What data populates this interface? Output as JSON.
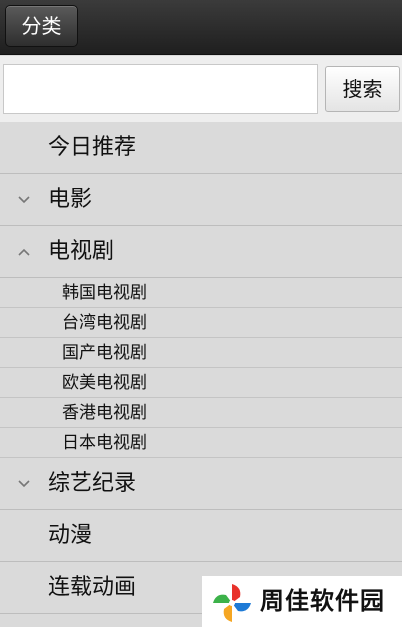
{
  "topbar": {
    "category_button": "分类"
  },
  "search": {
    "value": "",
    "placeholder": "",
    "button": "搜索"
  },
  "menu": {
    "items": [
      {
        "label": "今日推荐",
        "expandable": false
      },
      {
        "label": "电影",
        "expandable": true,
        "expanded": false
      },
      {
        "label": "电视剧",
        "expandable": true,
        "expanded": true,
        "children": [
          "韩国电视剧",
          "台湾电视剧",
          "国产电视剧",
          "欧美电视剧",
          "香港电视剧",
          "日本电视剧"
        ]
      },
      {
        "label": "综艺纪录",
        "expandable": true,
        "expanded": false
      },
      {
        "label": "动漫",
        "expandable": false
      },
      {
        "label": "连载动画",
        "expandable": false
      }
    ]
  },
  "watermark": {
    "text": "周佳软件园"
  },
  "colors": {
    "topbar": "#2a2a2a",
    "menu_bg": "#dadada",
    "search_bg": "#eeeeee",
    "text": "#111111"
  }
}
